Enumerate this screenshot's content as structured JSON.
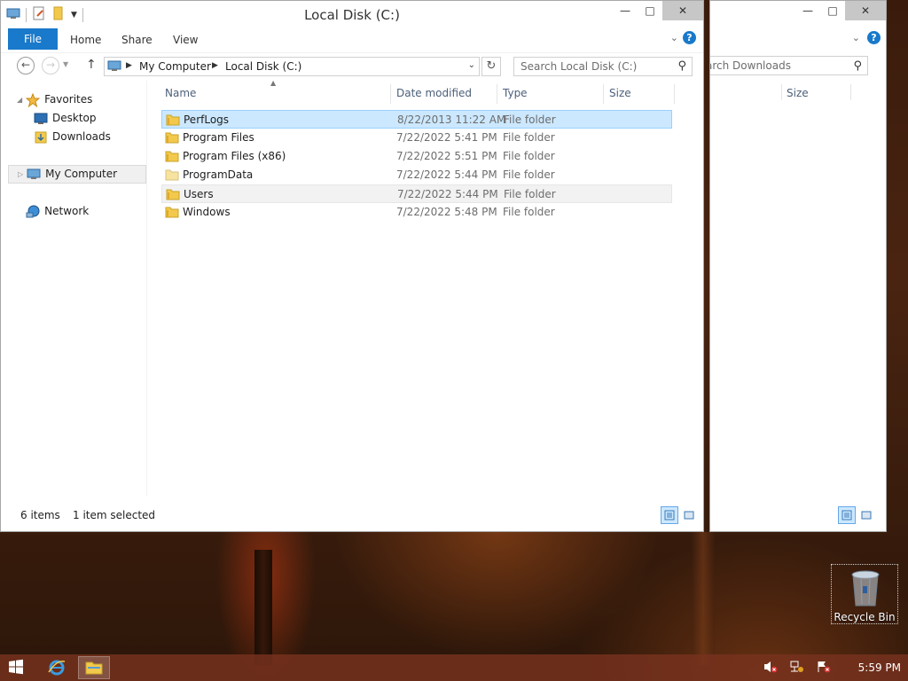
{
  "main_window": {
    "title": "Local Disk (C:)",
    "ribbon": {
      "file": "File",
      "home": "Home",
      "share": "Share",
      "view": "View"
    },
    "address": {
      "root": "My Computer",
      "current": "Local Disk (C:)"
    },
    "search_placeholder": "Search Local Disk (C:)",
    "columns": {
      "name": "Name",
      "date": "Date modified",
      "type": "Type",
      "size": "Size"
    },
    "nav_pane": {
      "favorites": "Favorites",
      "desktop": "Desktop",
      "downloads": "Downloads",
      "computer": "My Computer",
      "network": "Network"
    },
    "files": [
      {
        "name": "PerfLogs",
        "date": "8/22/2013 11:22 AM",
        "type": "File folder"
      },
      {
        "name": "Program Files",
        "date": "7/22/2022 5:41 PM",
        "type": "File folder"
      },
      {
        "name": "Program Files (x86)",
        "date": "7/22/2022 5:51 PM",
        "type": "File folder"
      },
      {
        "name": "ProgramData",
        "date": "7/22/2022 5:44 PM",
        "type": "File folder"
      },
      {
        "name": "Users",
        "date": "7/22/2022 5:44 PM",
        "type": "File folder"
      },
      {
        "name": "Windows",
        "date": "7/22/2022 5:48 PM",
        "type": "File folder"
      }
    ],
    "status": {
      "count": "6 items",
      "selected": "1 item selected"
    }
  },
  "back_window": {
    "search_placeholder": "Search Downloads",
    "search_visible": "arch Downloads",
    "size_header": "Size"
  },
  "desktop": {
    "recycle_bin": "Recycle Bin"
  },
  "taskbar": {
    "clock": "5:59 PM"
  },
  "colors": {
    "accent": "#1979ca",
    "selection": "#cce8ff",
    "selection_border": "#99d1ff"
  }
}
